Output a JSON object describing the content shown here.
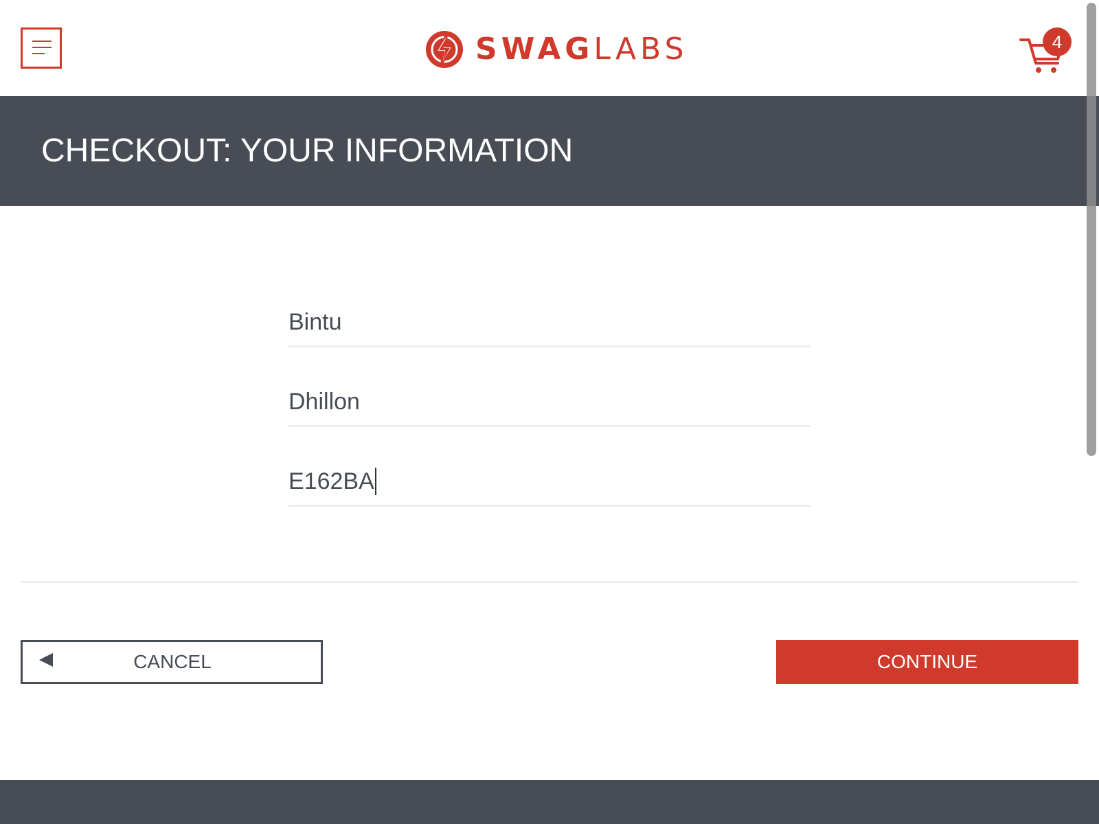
{
  "header": {
    "menu_icon": "hamburger-menu-icon",
    "logo": {
      "icon": "lightning-bolt-icon",
      "text_bold": "SWAG",
      "text_light": "LABS"
    },
    "cart": {
      "icon": "shopping-cart-icon",
      "badge_count": "4"
    }
  },
  "title_bar": {
    "title": "CHECKOUT: YOUR INFORMATION"
  },
  "form": {
    "first_name": {
      "value": "Bintu"
    },
    "last_name": {
      "value": "Dhillon"
    },
    "postal_code": {
      "value": "E162BA",
      "focused": true
    }
  },
  "actions": {
    "cancel_label": "CANCEL",
    "cancel_icon": "back-arrow-icon",
    "continue_label": "CONTINUE"
  },
  "colors": {
    "brand_red": "#d03a2c",
    "dark_gray": "#474c55",
    "divider": "#ededed"
  }
}
